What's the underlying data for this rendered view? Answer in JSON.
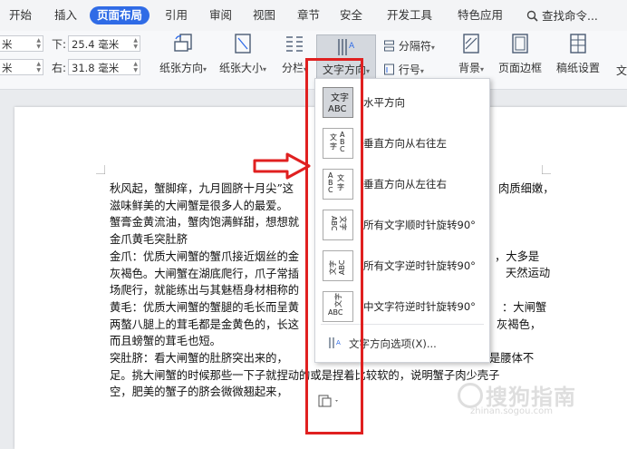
{
  "tabs": [
    "开始",
    "插入",
    "页面布局",
    "引用",
    "审阅",
    "视图",
    "章节",
    "安全",
    "开发工具",
    "特色应用"
  ],
  "active_tab": "页面布局",
  "search": {
    "label": "查找命令..."
  },
  "margins": {
    "top_label": "下:",
    "top_value": "25.4 毫米",
    "right_label": "右:",
    "right_value": "31.8 毫米",
    "left_top_value": "米",
    "left_bottom_value": "米"
  },
  "toolbar": {
    "orientation": "纸张方向",
    "size": "纸张大小",
    "columns": "分栏",
    "text_direction": "文字方向",
    "separator": "分隔符",
    "line_number": "行号",
    "background": "背景",
    "page_border": "页面边框",
    "manuscript": "稿纸设置",
    "cut": "文"
  },
  "dropdown": {
    "items": [
      {
        "label": "水平方向",
        "icon_text": "文字ABC"
      },
      {
        "label": "垂直方向从右往左",
        "icon_text": "ABC文字"
      },
      {
        "label": "垂直方向从左往右",
        "icon_text": "文字ABC"
      },
      {
        "label": "所有文字顺时针旋转90°",
        "icon_text": "文字ABC"
      },
      {
        "label": "所有文字逆时针旋转90°",
        "icon_text": "ABC文字"
      },
      {
        "label": "中文字符逆时针旋转90°",
        "icon_text": "文字ABC"
      }
    ],
    "options_label": "文字方向选项(X)..."
  },
  "document": {
    "lines": [
      "秋风起，蟹脚痒，九月圆脐十月尖”这",
      "滋味鲜美的大闸蟹是很多人的最爱。",
      "蟹膏金黄流油，蟹肉饱满鲜甜，想想就",
      "金爪黄毛突肚脐",
      "金爪：优质大闸蟹的蟹爪接近烟丝的金",
      "灰褐色。大闸蟹在湖底爬行，爪子常插",
      "场爬行，就能练出与其魅梧身材相称的",
      "黄毛：优质大闸蟹的蟹腿的毛长而呈黄",
      "两螯八腿上的茸毛都是金黄色的，长这",
      "而且螃蟹的茸毛也短。",
      "突肚脐：看大闸蟹的肚脐突出来的，",
      "足。挑大闸蟹的时候那些一下子就捏动的或是捏着比较软的，说明蟹子肉少壳子",
      "空，肥美的蟹子的脐会微微翘起来，"
    ],
    "right_fragments": [
      "肉质细嫩，",
      "，大多是",
      "天然运动",
      "：大闸蟹",
      "灰褐色，",
      "是腰体不"
    ]
  },
  "watermark": {
    "text": "搜狗指南",
    "sub": "zhinan.sogou.com"
  },
  "colors": {
    "accent": "#2f6be6",
    "highlight": "#e02020",
    "arrow": "#e02020"
  }
}
